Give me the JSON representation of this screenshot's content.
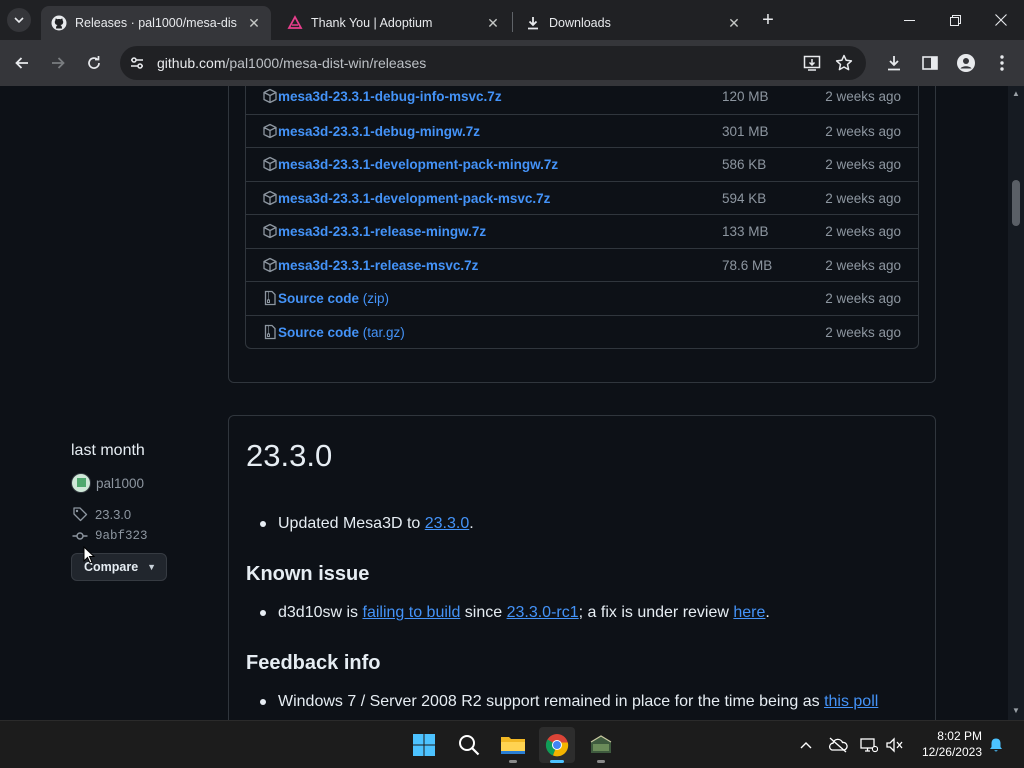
{
  "browser": {
    "tabs": [
      {
        "title": "Releases · pal1000/mesa-dist-wi",
        "active": true,
        "favicon": "github-icon"
      },
      {
        "title": "Thank You | Adoptium",
        "active": false,
        "favicon": "adoptium-icon"
      },
      {
        "title": "Downloads",
        "active": false,
        "favicon": "download-icon"
      }
    ],
    "url_host": "github.com",
    "url_path": "/pal1000/mesa-dist-win/releases"
  },
  "assets": [
    {
      "name": "mesa3d-23.3.1-debug-info-msvc.7z",
      "size": "120 MB",
      "date": "2 weeks ago"
    },
    {
      "name": "mesa3d-23.3.1-debug-mingw.7z",
      "size": "301 MB",
      "date": "2 weeks ago"
    },
    {
      "name": "mesa3d-23.3.1-development-pack-mingw.7z",
      "size": "586 KB",
      "date": "2 weeks ago"
    },
    {
      "name": "mesa3d-23.3.1-development-pack-msvc.7z",
      "size": "594 KB",
      "date": "2 weeks ago"
    },
    {
      "name": "mesa3d-23.3.1-release-mingw.7z",
      "size": "133 MB",
      "date": "2 weeks ago"
    },
    {
      "name": "mesa3d-23.3.1-release-msvc.7z",
      "size": "78.6 MB",
      "date": "2 weeks ago"
    }
  ],
  "source_code": [
    {
      "label": "Source code",
      "format": "(zip)",
      "date": "2 weeks ago"
    },
    {
      "label": "Source code",
      "format": "(tar.gz)",
      "date": "2 weeks ago"
    }
  ],
  "release_meta": {
    "when": "last month",
    "author": "pal1000",
    "tag": "23.3.0",
    "commit": "9abf323",
    "compare_label": "Compare"
  },
  "release": {
    "title": "23.3.0",
    "bullet1_prefix": "Updated Mesa3D to ",
    "bullet1_link": "23.3.0",
    "bullet1_suffix": ".",
    "known_issue_heading": "Known issue",
    "issue_prefix": "d3d10sw is ",
    "issue_link1": "failing to build",
    "issue_mid": " since ",
    "issue_link2": "23.3.0-rc1",
    "issue_mid2": "; a fix is under review ",
    "issue_link3": "here",
    "issue_suffix": ".",
    "feedback_heading": "Feedback info",
    "feedback_prefix": "Windows 7 / Server 2008 R2 support remained in place for the time being as ",
    "feedback_link": "this poll"
  },
  "taskbar": {
    "time": "8:02 PM",
    "date": "12/26/2023"
  },
  "colors": {
    "link": "#4493f8",
    "page_bg": "#0d1117",
    "border": "#30363d"
  }
}
